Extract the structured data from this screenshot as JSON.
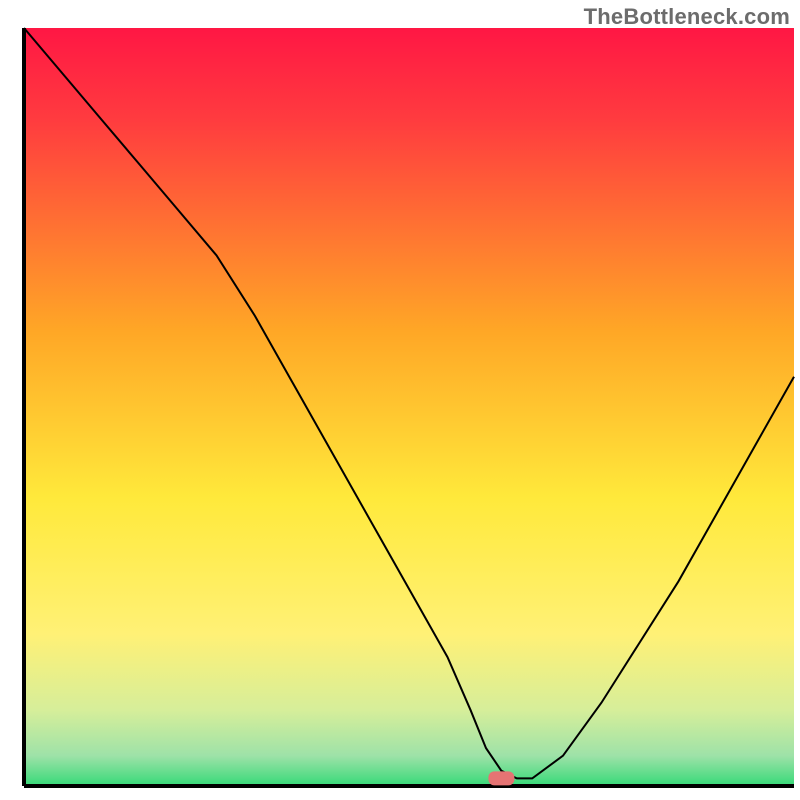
{
  "watermark": "TheBottleneck.com",
  "chart_data": {
    "type": "line",
    "title": "",
    "xlabel": "",
    "ylabel": "",
    "xlim": [
      0,
      100
    ],
    "ylim": [
      0,
      100
    ],
    "x": [
      0,
      5,
      10,
      15,
      20,
      25,
      30,
      35,
      40,
      45,
      50,
      55,
      58,
      60,
      62,
      64,
      66,
      70,
      75,
      80,
      85,
      90,
      95,
      100
    ],
    "values": [
      100,
      94,
      88,
      82,
      76,
      70,
      62,
      53,
      44,
      35,
      26,
      17,
      10,
      5,
      2,
      1,
      1,
      4,
      11,
      19,
      27,
      36,
      45,
      54
    ],
    "background_gradient": {
      "stops": [
        {
          "pct": 0,
          "color": "#ff1744"
        },
        {
          "pct": 12,
          "color": "#ff3b3f"
        },
        {
          "pct": 40,
          "color": "#ffa726"
        },
        {
          "pct": 62,
          "color": "#ffe93b"
        },
        {
          "pct": 80,
          "color": "#fff176"
        },
        {
          "pct": 90,
          "color": "#d6ee9a"
        },
        {
          "pct": 96,
          "color": "#9ee2a8"
        },
        {
          "pct": 100,
          "color": "#36d978"
        }
      ]
    },
    "marker": {
      "x": 62,
      "y": 1,
      "color": "#e57373"
    },
    "axis_color": "#000000",
    "line_color": "#000000",
    "line_width": 2
  }
}
